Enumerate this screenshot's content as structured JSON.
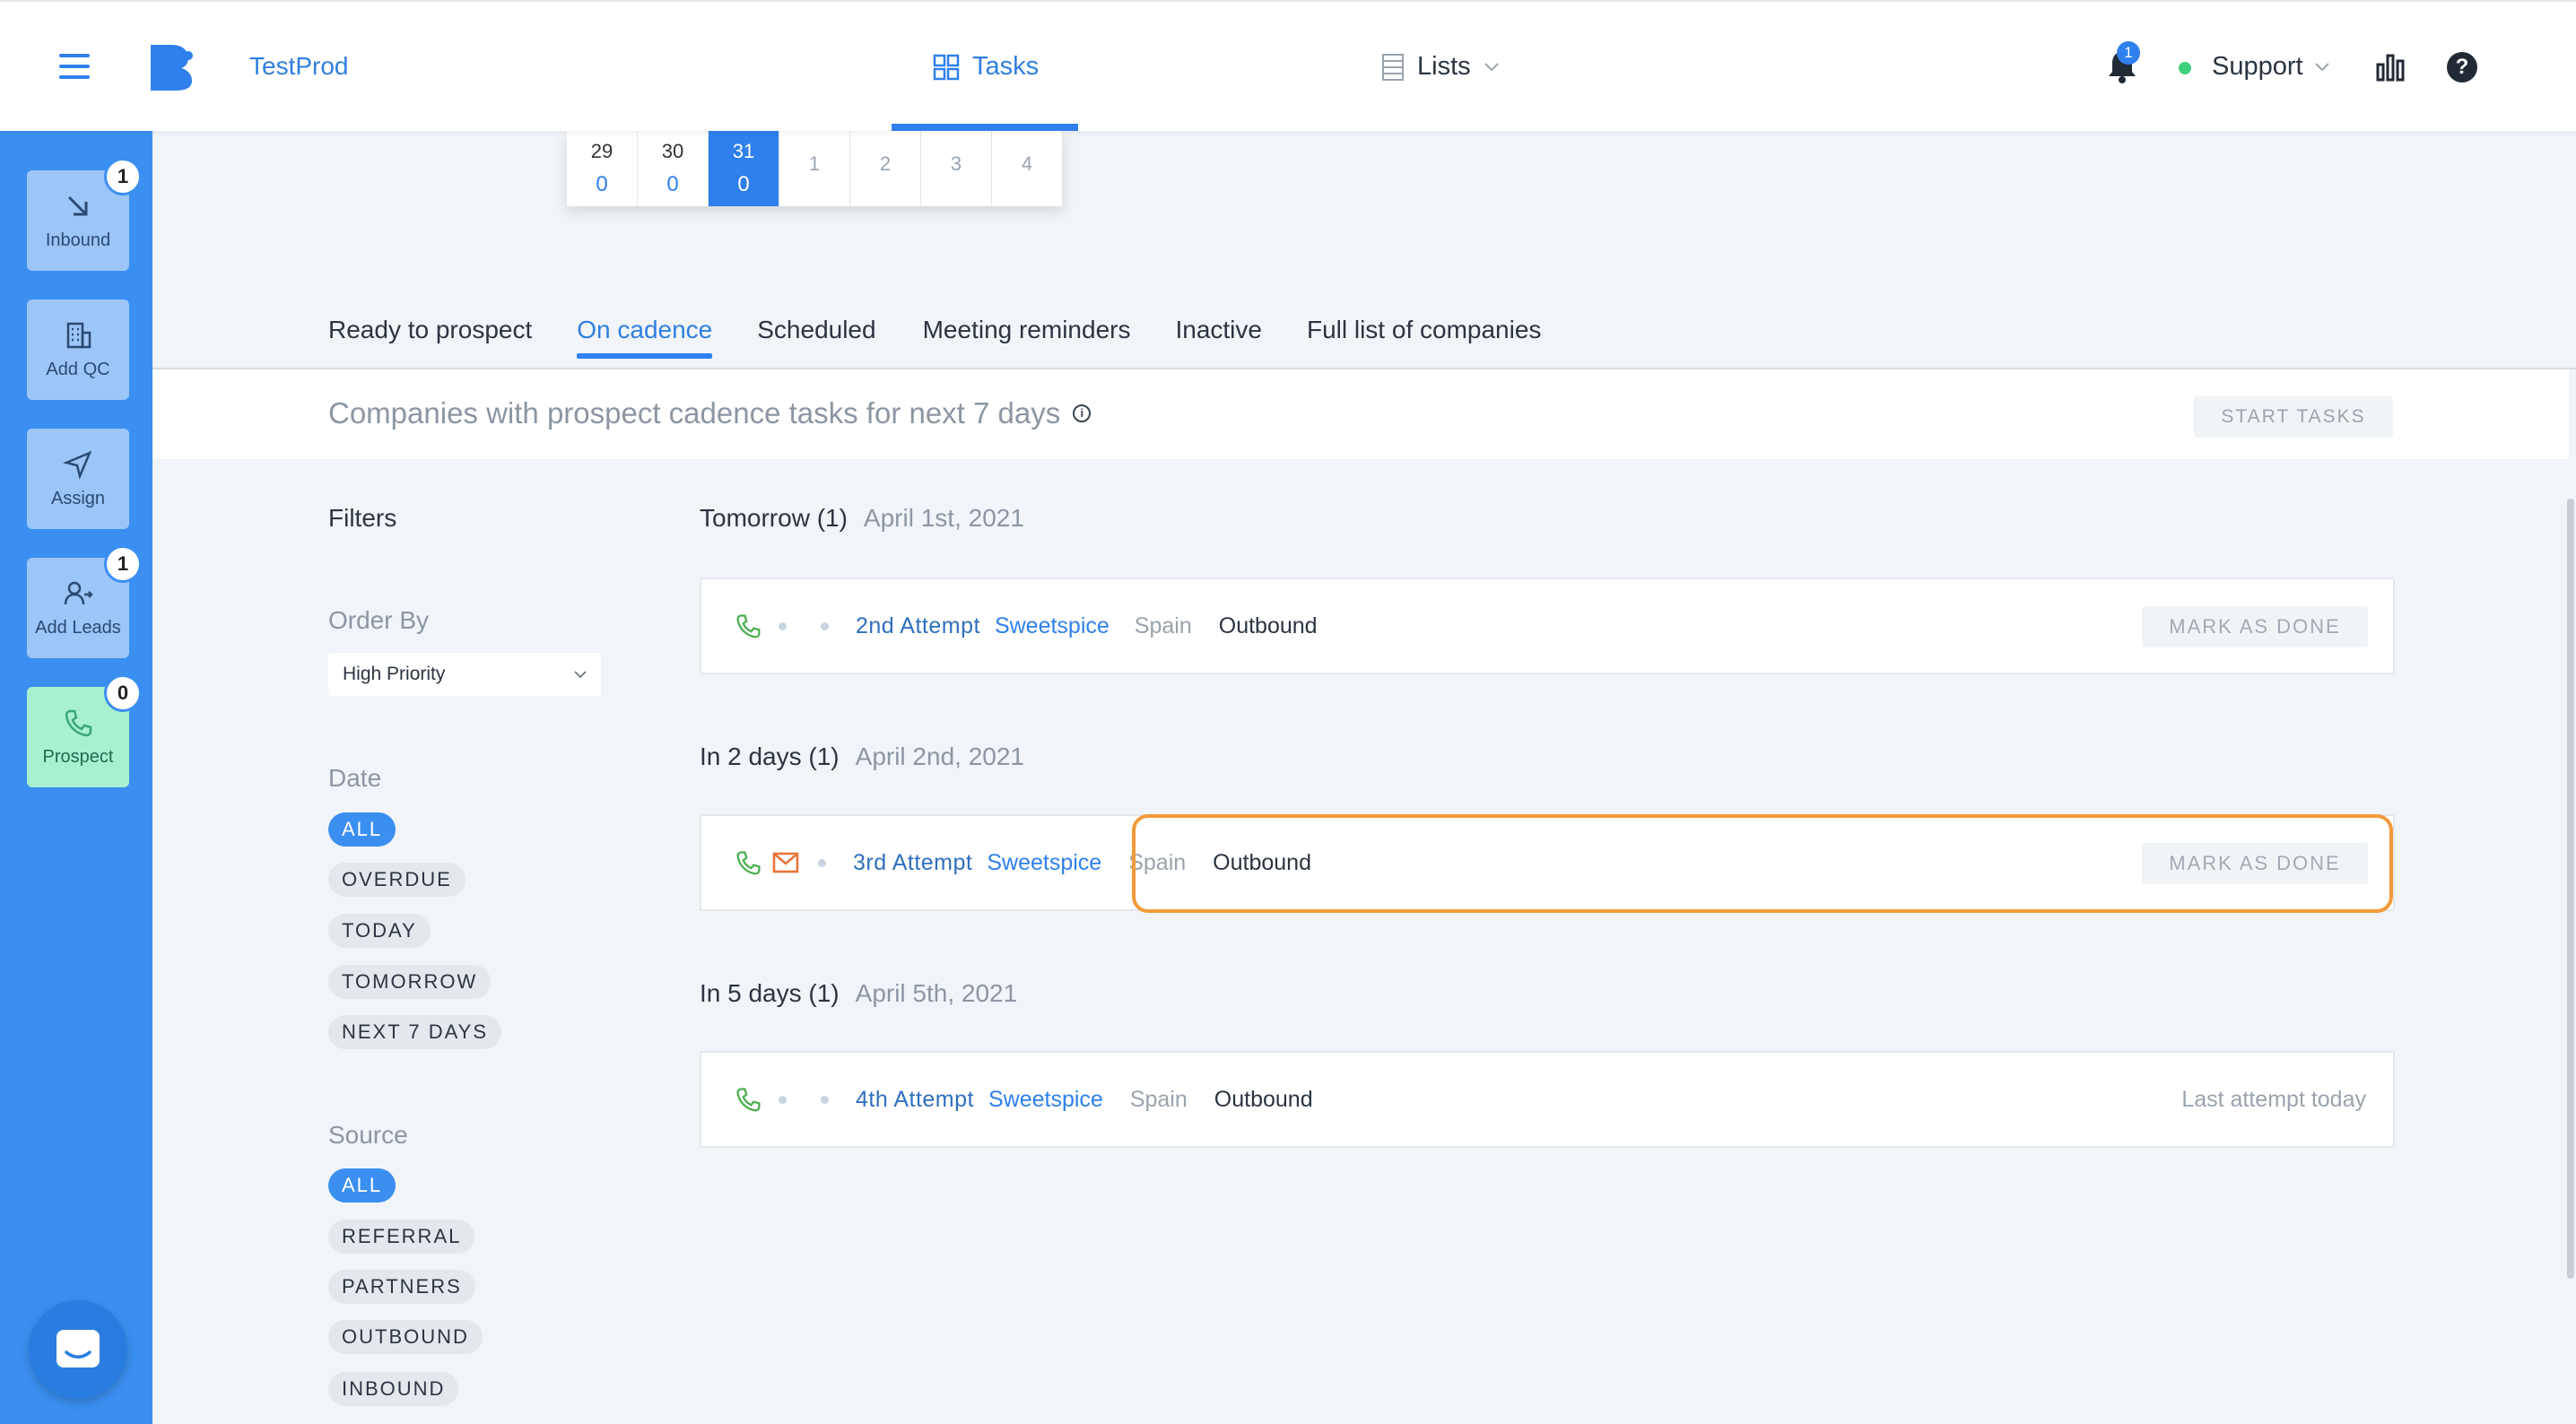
{
  "app": {
    "brand": "TestProd"
  },
  "topnav": {
    "tasks_label": "Tasks",
    "lists_label": "Lists",
    "notifications_count": "1",
    "user_label": "Support"
  },
  "sidebar": {
    "items": [
      {
        "label": "Inbound",
        "badge": "1"
      },
      {
        "label": "Add QC",
        "badge": ""
      },
      {
        "label": "Assign",
        "badge": ""
      },
      {
        "label": "Add Leads",
        "badge": "1"
      },
      {
        "label": "Prospect",
        "badge": "0"
      }
    ]
  },
  "calendar": {
    "days": [
      {
        "day": "29",
        "count": "0"
      },
      {
        "day": "30",
        "count": "0"
      },
      {
        "day": "31",
        "count": "0",
        "selected": true
      },
      {
        "day": "1",
        "count": ""
      },
      {
        "day": "2",
        "count": ""
      },
      {
        "day": "3",
        "count": ""
      },
      {
        "day": "4",
        "count": ""
      }
    ]
  },
  "tabs": [
    "Ready to prospect",
    "On cadence",
    "Scheduled",
    "Meeting reminders",
    "Inactive",
    "Full list of companies"
  ],
  "active_tab": "On cadence",
  "header": {
    "title": "Companies with prospect cadence tasks for next 7 days",
    "start_button": "START TASKS"
  },
  "filters": {
    "title": "Filters",
    "order_by_label": "Order By",
    "order_by_value": "High Priority",
    "date_label": "Date",
    "date_options": [
      "ALL",
      "OVERDUE",
      "TODAY",
      "TOMORROW",
      "NEXT 7 DAYS"
    ],
    "source_label": "Source",
    "source_options": [
      "ALL",
      "REFERRAL",
      "PARTNERS",
      "OUTBOUND",
      "INBOUND"
    ]
  },
  "groups": [
    {
      "heading": "Tomorrow (1)",
      "date": "April 1st, 2021",
      "task": {
        "attempt": "2nd Attempt",
        "company": "Sweetspice",
        "country": "Spain",
        "source": "Outbound",
        "action": "MARK AS DONE"
      }
    },
    {
      "heading": "In 2 days (1)",
      "date": "April 2nd, 2021",
      "task": {
        "attempt": "3rd Attempt",
        "company": "Sweetspice",
        "country": "Spain",
        "source": "Outbound",
        "action": "MARK AS DONE"
      }
    },
    {
      "heading": "In 5 days (1)",
      "date": "April 5th, 2021",
      "task": {
        "attempt": "4th Attempt",
        "company": "Sweetspice",
        "country": "Spain",
        "source": "Outbound",
        "status": "Last attempt today"
      }
    }
  ],
  "colors": {
    "primary": "#2f80ed",
    "sidebar": "#3b8ff0",
    "highlight": "#f29a3a",
    "phone": "#4caf50",
    "email": "#e8743b"
  }
}
